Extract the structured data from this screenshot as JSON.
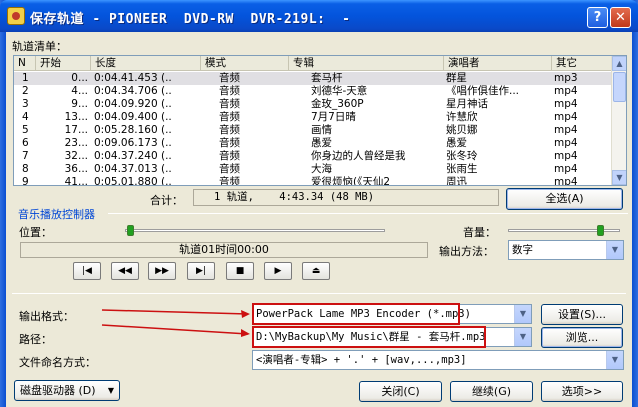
{
  "window": {
    "title": "保存轨道 - PIONEER  DVD-RW  DVR-219L:  -",
    "help_glyph": "?",
    "close_glyph": "✕"
  },
  "tracklist": {
    "label": "轨道清单：",
    "columns": [
      "N",
      "开始",
      "长度",
      "模式",
      "专辑",
      "演唱者",
      "其它"
    ],
    "rows": [
      {
        "n": "1",
        "start": "0...",
        "length": "0:04.41.453 (..",
        "mode": "音频",
        "album": "套马杆",
        "artist": "群星",
        "other": "mp3"
      },
      {
        "n": "2",
        "start": "4...",
        "length": "0:04.34.706 (..",
        "mode": "音频",
        "album": "刘德华-天意",
        "artist": "《唱作俱佳作...",
        "other": "mp4"
      },
      {
        "n": "3",
        "start": "9...",
        "length": "0:04.09.920 (..",
        "mode": "音频",
        "album": "金玫_360P",
        "artist": "星月神话",
        "other": "mp4"
      },
      {
        "n": "4",
        "start": "13...",
        "length": "0:04.09.400 (..",
        "mode": "音频",
        "album": "7月7日晴",
        "artist": "许慧欣",
        "other": "mp4"
      },
      {
        "n": "5",
        "start": "17...",
        "length": "0:05.28.160 (..",
        "mode": "音频",
        "album": "画情",
        "artist": "姚贝娜",
        "other": "mp4"
      },
      {
        "n": "6",
        "start": "23...",
        "length": "0:09.06.173 (..",
        "mode": "音频",
        "album": "愚爱",
        "artist": "愚爱",
        "other": "mp4"
      },
      {
        "n": "7",
        "start": "32...",
        "length": "0:04.37.240 (..",
        "mode": "音频",
        "album": "你身边的人曾经是我",
        "artist": "张冬玲",
        "other": "mp4"
      },
      {
        "n": "8",
        "start": "36...",
        "length": "0:04.37.013 (..",
        "mode": "音频",
        "album": "大海",
        "artist": "张雨生",
        "other": "mp4"
      },
      {
        "n": "9",
        "start": "41...",
        "length": "0:05.01.880 (..",
        "mode": "音频",
        "album": "爱很烦恼(《天仙2",
        "artist": "周迅",
        "other": "mp4"
      }
    ],
    "scroll_up": "▲",
    "scroll_down": "▼"
  },
  "summary": {
    "label": "合计：",
    "value": "1 轨道,    4:43.34 (48 MB)",
    "select_all": "全选(A)"
  },
  "player": {
    "section_title": "音乐播放控制器",
    "position_label": "位置：",
    "volume_label": "音量：",
    "position_fraction": 0.02,
    "volume_fraction": 0.82,
    "status": "轨道01时间00:00",
    "output_method_label": "输出方法：",
    "output_method_value": "数字",
    "buttons": [
      "|◀",
      "◀◀",
      "▶▶",
      "▶|",
      "■",
      "▶",
      "⏏"
    ]
  },
  "output": {
    "format_label": "输出格式：",
    "format_value": "PowerPack Lame MP3 Encoder (*.mp3)",
    "settings_button": "设置(S)...",
    "path_label": "路径：",
    "path_value": "D:\\MyBackup\\My Music\\群星 - 套马杆.mp3",
    "browse_button": "浏览...",
    "naming_label": "文件命名方式：",
    "naming_value": "<演唱者-专辑> + '.' + [wav,...,mp3]"
  },
  "footer": {
    "drive_button": "磁盘驱动器 (D)",
    "drive_arrow": "▼",
    "close_button": "关闭(C)",
    "continue_button": "继续(G)",
    "options_button": "选项>>"
  },
  "colors": {
    "accent_blue": "#0046d5",
    "annotation_red": "#cc1010",
    "title_blue": "#0354dc"
  }
}
